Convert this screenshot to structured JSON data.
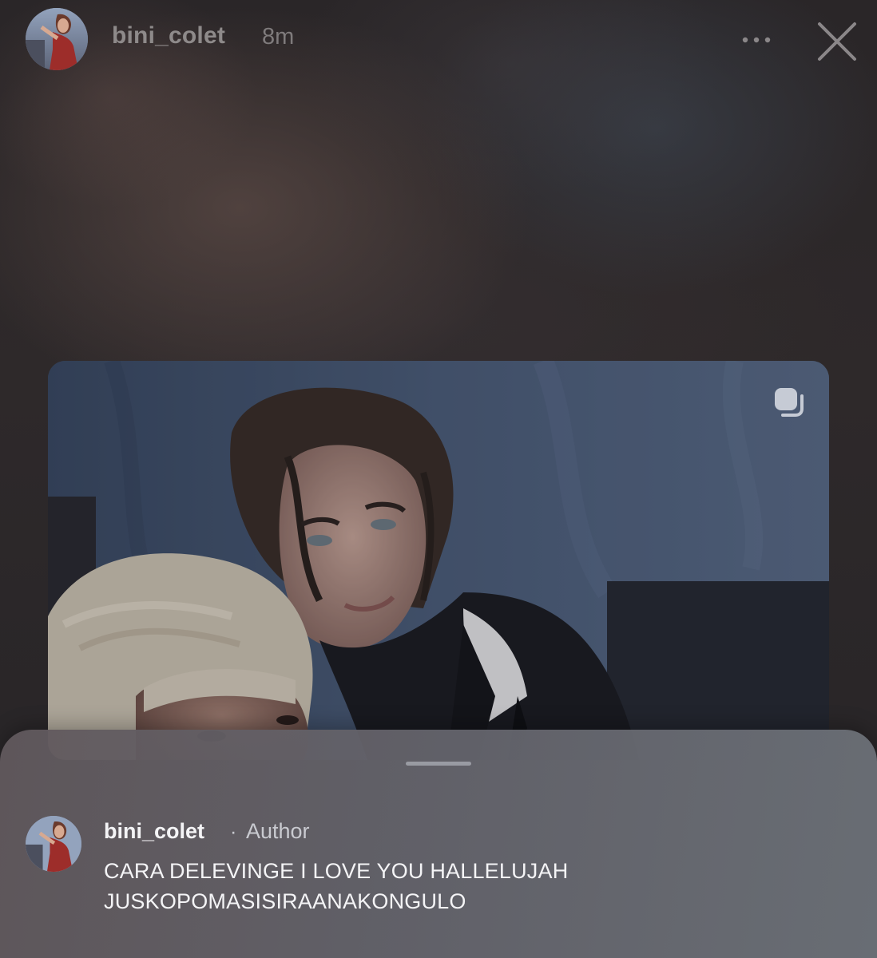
{
  "story": {
    "username": "bini_colet",
    "time_ago": "8m",
    "more_icon": "ellipsis-icon",
    "close_icon": "close-icon"
  },
  "post": {
    "multi_icon": "carousel-icon"
  },
  "comment": {
    "username": "bini_colet",
    "separator": "·",
    "role": "Author",
    "text_line1": "CARA DELEVINGE I LOVE YOU HALLELUJAH",
    "text_line2": "JUSKOPOMASISIRAANAKONGULO"
  }
}
